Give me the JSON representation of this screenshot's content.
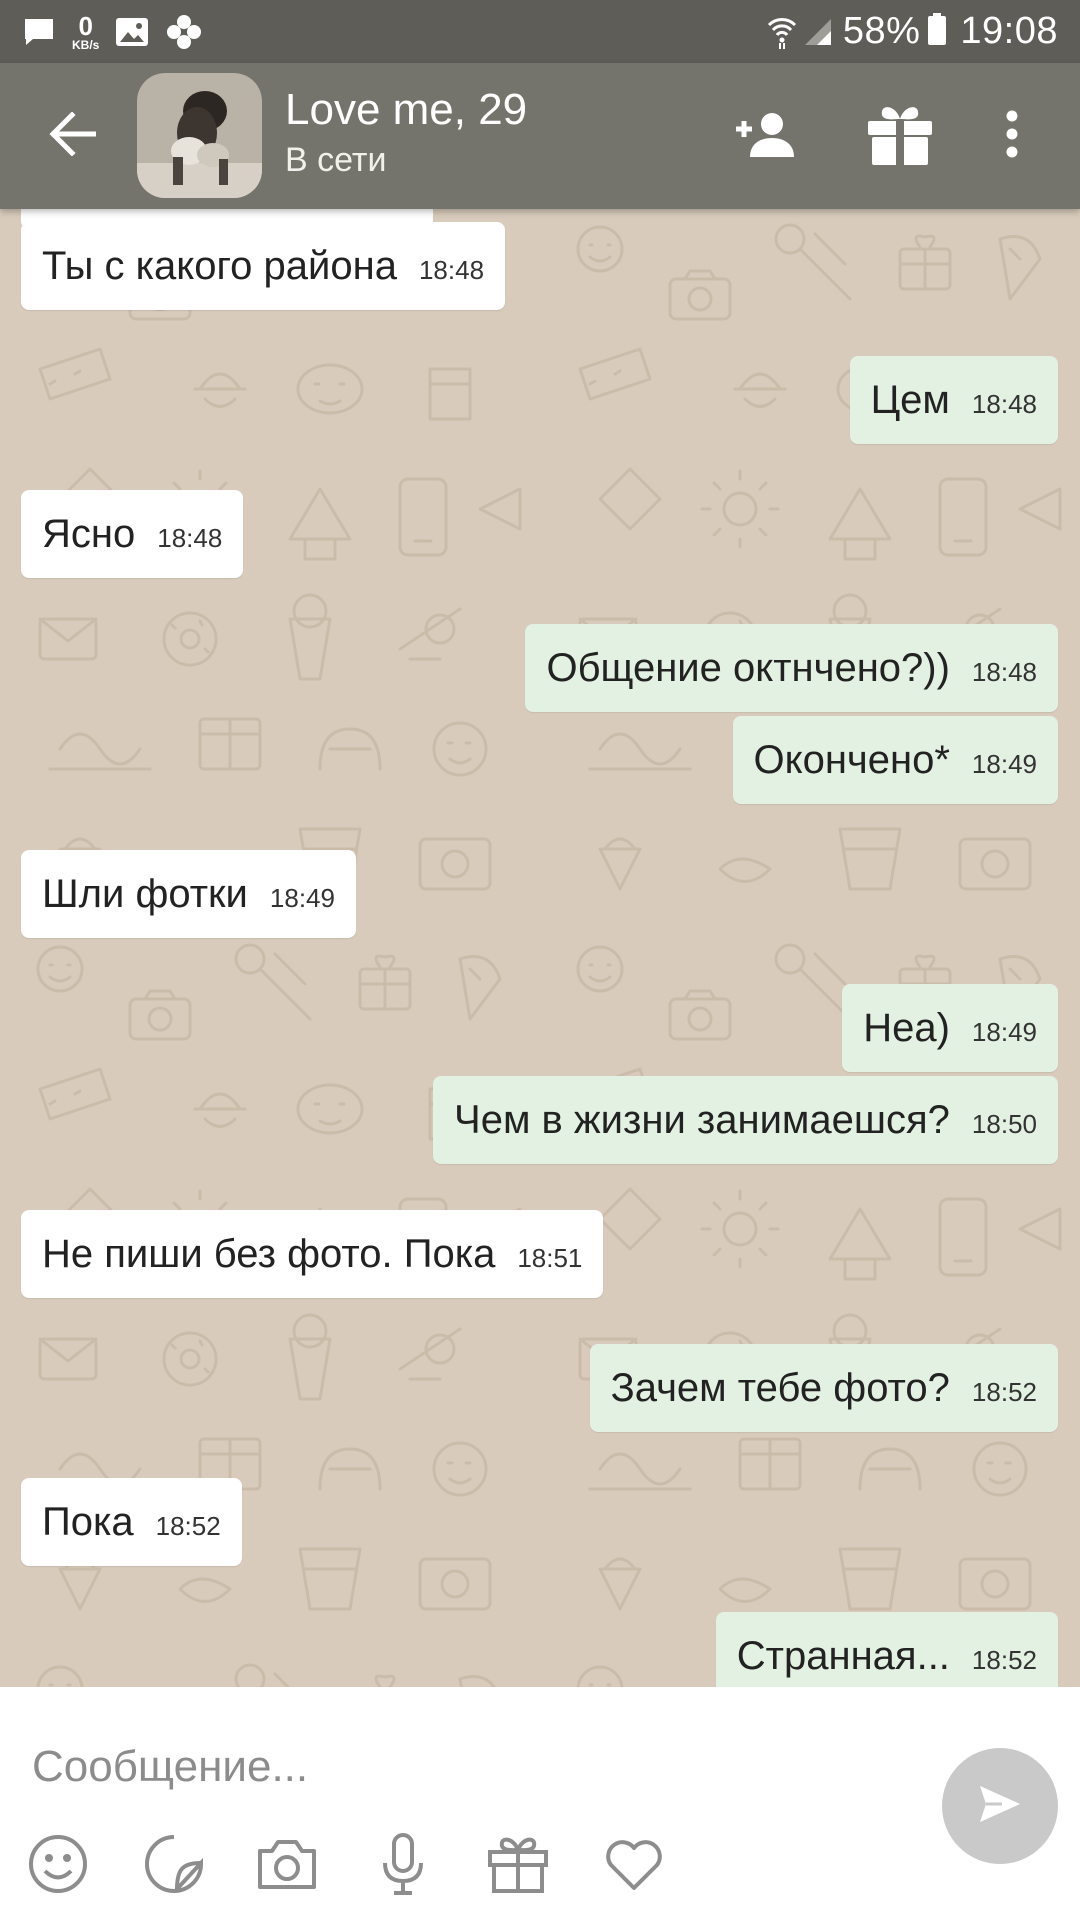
{
  "status_bar": {
    "net_speed_value": "0",
    "net_speed_unit": "KB/s",
    "battery": "58%",
    "time": "19:08",
    "icons": [
      "message-icon",
      "image-icon",
      "app-icon",
      "wifi-icon",
      "signal-icon",
      "battery-icon"
    ]
  },
  "header": {
    "contact_name": "Love me, 29",
    "contact_status": "В сети",
    "actions": [
      "back-arrow-icon",
      "add-friend-icon",
      "gift-icon",
      "more-vertical-icon"
    ]
  },
  "messages": [
    {
      "dir": "in",
      "text": "Ты с какого района",
      "time": "18:48"
    },
    {
      "dir": "out",
      "text": "Цем",
      "time": "18:48"
    },
    {
      "dir": "in",
      "text": "Ясно",
      "time": "18:48"
    },
    {
      "dir": "out",
      "text": "Общение октнчено?))",
      "time": "18:48"
    },
    {
      "dir": "out",
      "text": "Окончено*",
      "time": "18:49"
    },
    {
      "dir": "in",
      "text": "Шли фотки",
      "time": "18:49"
    },
    {
      "dir": "out",
      "text": "Неа)",
      "time": "18:49"
    },
    {
      "dir": "out",
      "text": "Чем в жизни занимаешся?",
      "time": "18:50"
    },
    {
      "dir": "in",
      "text": "Не пиши без фото. Пока",
      "time": "18:51"
    },
    {
      "dir": "out",
      "text": "Зачем тебе фото?",
      "time": "18:52"
    },
    {
      "dir": "in",
      "text": "Пока",
      "time": "18:52"
    },
    {
      "dir": "out",
      "text": "Странная...",
      "time": "18:52"
    }
  ],
  "composer": {
    "placeholder": "Сообщение...",
    "value": "",
    "tools": [
      "emoji-icon",
      "sticker-icon",
      "camera-icon",
      "microphone-icon",
      "gift-icon",
      "heart-icon"
    ],
    "send": "send-icon"
  },
  "colors": {
    "status_bar": "#5e5d58",
    "app_bar": "#75746c",
    "chat_background": "#d8cbbb",
    "incoming_bubble": "#ffffff",
    "outgoing_bubble": "#e3f1e2",
    "send_button": "#c9c9c9"
  }
}
